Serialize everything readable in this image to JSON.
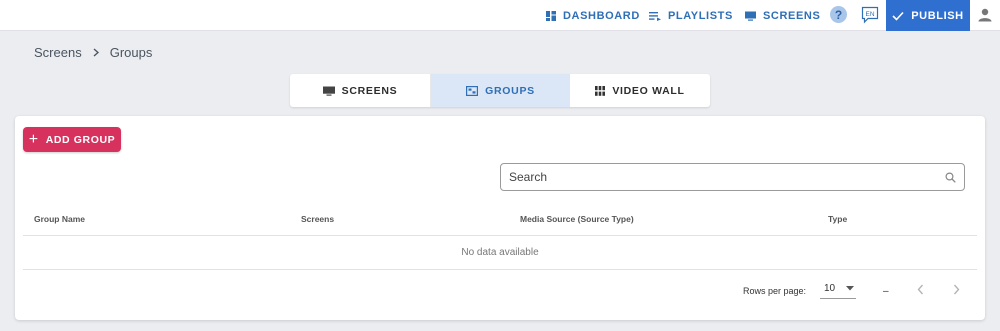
{
  "nav": {
    "dashboard": "DASHBOARD",
    "playlists": "PLAYLISTS",
    "screens": "SCREENS",
    "help": "?",
    "lang": "EN",
    "publish": "PUBLISH"
  },
  "breadcrumb": {
    "root": "Screens",
    "current": "Groups"
  },
  "tabs": [
    {
      "label": "SCREENS",
      "icon": "monitor-icon",
      "active": false
    },
    {
      "label": "GROUPS",
      "icon": "groups-icon",
      "active": true
    },
    {
      "label": "VIDEO WALL",
      "icon": "video-wall-icon",
      "active": false
    }
  ],
  "actions": {
    "add_group": "ADD GROUP"
  },
  "search": {
    "placeholder": "Search"
  },
  "table": {
    "columns": [
      "Group Name",
      "Screens",
      "Media Source (Source Type)",
      "Type"
    ],
    "empty": "No data available"
  },
  "pagination": {
    "rows_per_page_label": "Rows per page:",
    "rows_per_page": "10",
    "range": "–"
  },
  "colors": {
    "accent": "#2f6fb6",
    "publish": "#2f6fd0",
    "add_button": "#d7325e",
    "active_tab": "#dbe7f6"
  }
}
